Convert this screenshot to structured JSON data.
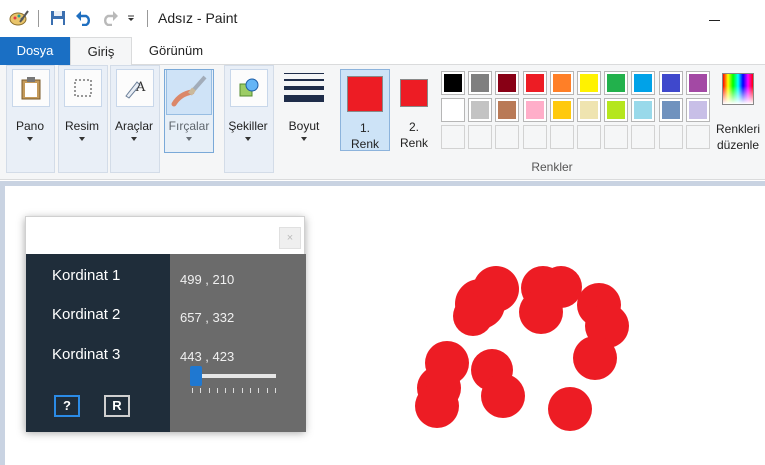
{
  "window": {
    "title": "Adsız - Paint"
  },
  "quick_access": {
    "icons": [
      "paint-app-icon",
      "save-icon",
      "undo-icon",
      "redo-icon",
      "customize-dropdown-icon"
    ]
  },
  "tabs": [
    {
      "label": "Dosya",
      "active": false
    },
    {
      "label": "Giriş",
      "active": true
    },
    {
      "label": "Görünüm",
      "active": false
    }
  ],
  "ribbon": {
    "tools": [
      {
        "label": "Pano",
        "icon": "clipboard-icon"
      },
      {
        "label": "Resim",
        "icon": "select-icon"
      },
      {
        "label": "Araçlar",
        "icon": "tools-icon"
      },
      {
        "label": "Fırçalar",
        "icon": "brush-icon",
        "active": true
      },
      {
        "label": "Şekiller",
        "icon": "shapes-icon"
      },
      {
        "label": "Boyut",
        "icon": "size-lines-icon"
      }
    ],
    "color1": {
      "label_line1": "1.",
      "label_line2": "Renk",
      "value": "#ed1c24"
    },
    "color2": {
      "label_line1": "2.",
      "label_line2": "Renk",
      "value": "#ed1c24"
    },
    "palette_row1": [
      "#000000",
      "#7f7f7f",
      "#880015",
      "#ed1c24",
      "#ff7f27",
      "#fff200",
      "#22b14c",
      "#00a2e8",
      "#3f48cc",
      "#a349a4"
    ],
    "palette_row2": [
      "#ffffff",
      "#c3c3c3",
      "#b97a57",
      "#ffaec9",
      "#ffc90e",
      "#efe4b0",
      "#b5e61d",
      "#99d9ea",
      "#7092be",
      "#c8bfe7"
    ],
    "palette_empty_count": 10,
    "edit_colors": {
      "label_line1": "Renkleri",
      "label_line2": "düzenle"
    },
    "colors_group_label": "Renkler"
  },
  "panel": {
    "close_glyph": "×",
    "rows": [
      {
        "label": "Kordinat 1",
        "value": "499 , 210"
      },
      {
        "label": "Kordinat 2",
        "value": "657 , 332"
      },
      {
        "label": "Kordinat 3",
        "value": "443 , 423"
      }
    ],
    "help_button": "?",
    "reset_button": "R",
    "slider_value": 0
  }
}
